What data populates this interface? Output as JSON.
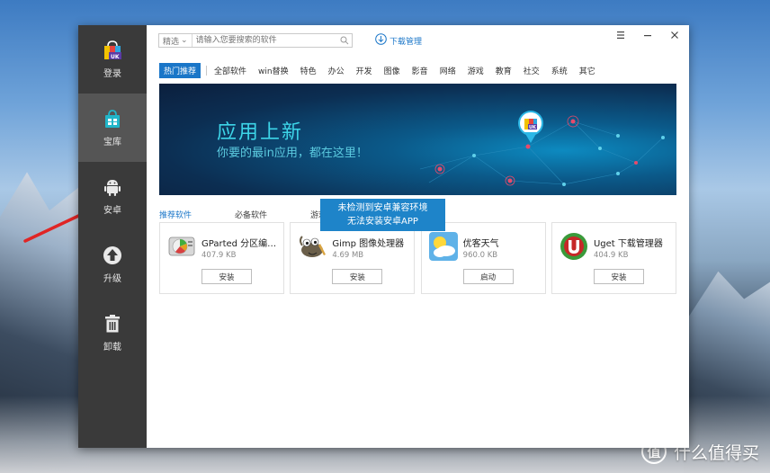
{
  "sidebar": {
    "items": [
      {
        "label": "登录",
        "icon": "uk-logo-icon",
        "active": false
      },
      {
        "label": "宝库",
        "icon": "bag-icon",
        "active": true
      },
      {
        "label": "安卓",
        "icon": "android-icon",
        "active": false
      },
      {
        "label": "升级",
        "icon": "upgrade-icon",
        "active": false
      },
      {
        "label": "卸载",
        "icon": "trash-icon",
        "active": false
      }
    ]
  },
  "search": {
    "category": "精选",
    "placeholder": "请输入您要搜索的软件"
  },
  "header": {
    "download_manager": "下载管理"
  },
  "categories": [
    "热门推荐",
    "全部软件",
    "win替换",
    "特色",
    "办公",
    "开发",
    "图像",
    "影音",
    "网络",
    "游戏",
    "教育",
    "社交",
    "系统",
    "其它"
  ],
  "banner": {
    "title": "应用上新",
    "subtitle": "你要的最in应用，都在这里！",
    "badge": "UK"
  },
  "rec_tabs": [
    "推荐软件",
    "必备软件",
    "游戏"
  ],
  "tooltip": {
    "line1": "未检测到安卓兼容环境",
    "line2": "无法安装安卓APP"
  },
  "apps": [
    {
      "name": "GParted 分区编辑器",
      "display_name": "GParted 分区编…",
      "size": "407.9 KB",
      "action": "安装",
      "icon": "gparted-icon"
    },
    {
      "name": "Gimp 图像处理器",
      "display_name": "Gimp 图像处理器",
      "size": "4.69 MB",
      "action": "安装",
      "icon": "gimp-icon"
    },
    {
      "name": "优客天气",
      "display_name": "优客天气",
      "size": "960.0 KB",
      "action": "启动",
      "icon": "weather-icon"
    },
    {
      "name": "Uget 下载管理器",
      "display_name": "Uget 下载管理器",
      "size": "404.9 KB",
      "action": "安装",
      "icon": "uget-icon"
    }
  ],
  "watermark": {
    "badge": "值",
    "text": "什么值得买"
  },
  "colors": {
    "accent": "#1a76c8",
    "sidebar": "#3a3a3a",
    "sidebar_active": "#555555",
    "tooltip": "#1e84c9",
    "arrow": "#e02525"
  }
}
